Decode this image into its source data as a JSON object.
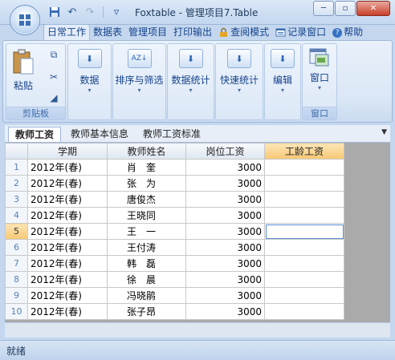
{
  "window": {
    "title": "Foxtable - 管理项目7.Table",
    "minimize": "─",
    "maximize": "▫",
    "close": "✕"
  },
  "qat": {
    "save_icon": "save-icon",
    "undo_icon": "undo-icon",
    "redo_icon": "redo-icon",
    "customize": "▿"
  },
  "ribbon_tabs": [
    {
      "label": "日常工作"
    },
    {
      "label": "数据表"
    },
    {
      "label": "管理项目"
    },
    {
      "label": "打印输出"
    },
    {
      "label": "查阅模式"
    },
    {
      "label": "记录窗口"
    },
    {
      "label": "帮助"
    }
  ],
  "ribbon": {
    "clipboard": {
      "paste": "粘贴",
      "group_label": "剪贴板"
    },
    "data": "数据",
    "sort_filter": "排序与筛选",
    "stats": "数据统计",
    "quick_stats": "快速统计",
    "edit": "编辑",
    "window": {
      "label": "窗口",
      "group_label": "窗口"
    },
    "arrow": "▾",
    "tile_glyph": "⬇",
    "sort_glyph": "AZ↓"
  },
  "sheet_tabs": [
    {
      "label": "教师工资"
    },
    {
      "label": "教师基本信息"
    },
    {
      "label": "教师工资标准"
    }
  ],
  "sheet_scroll": "▼",
  "grid": {
    "columns": [
      "学期",
      "教师姓名",
      "岗位工资",
      "工龄工资"
    ],
    "rows": [
      {
        "n": "1",
        "term": "2012年(春)",
        "name": "肖　奎",
        "wage": "3000",
        "seniority": ""
      },
      {
        "n": "2",
        "term": "2012年(春)",
        "name": "张　为",
        "wage": "3000",
        "seniority": ""
      },
      {
        "n": "3",
        "term": "2012年(春)",
        "name": "唐俊杰",
        "wage": "3000",
        "seniority": ""
      },
      {
        "n": "4",
        "term": "2012年(春)",
        "name": "王晓同",
        "wage": "3000",
        "seniority": ""
      },
      {
        "n": "5",
        "term": "2012年(春)",
        "name": "王　一",
        "wage": "3000",
        "seniority": ""
      },
      {
        "n": "6",
        "term": "2012年(春)",
        "name": "王付涛",
        "wage": "3000",
        "seniority": ""
      },
      {
        "n": "7",
        "term": "2012年(春)",
        "name": "韩　磊",
        "wage": "3000",
        "seniority": ""
      },
      {
        "n": "8",
        "term": "2012年(春)",
        "name": "徐　晨",
        "wage": "3000",
        "seniority": ""
      },
      {
        "n": "9",
        "term": "2012年(春)",
        "name": "冯晓鹃",
        "wage": "3000",
        "seniority": ""
      },
      {
        "n": "10",
        "term": "2012年(春)",
        "name": "张子昂",
        "wage": "3000",
        "seniority": ""
      }
    ],
    "current_row": 5,
    "active_column": 4
  },
  "status": {
    "text": "就绪"
  },
  "colors": {
    "accent": "#15428b",
    "active_header": "#f7c873",
    "grid_bg": "#aaaaaa"
  }
}
